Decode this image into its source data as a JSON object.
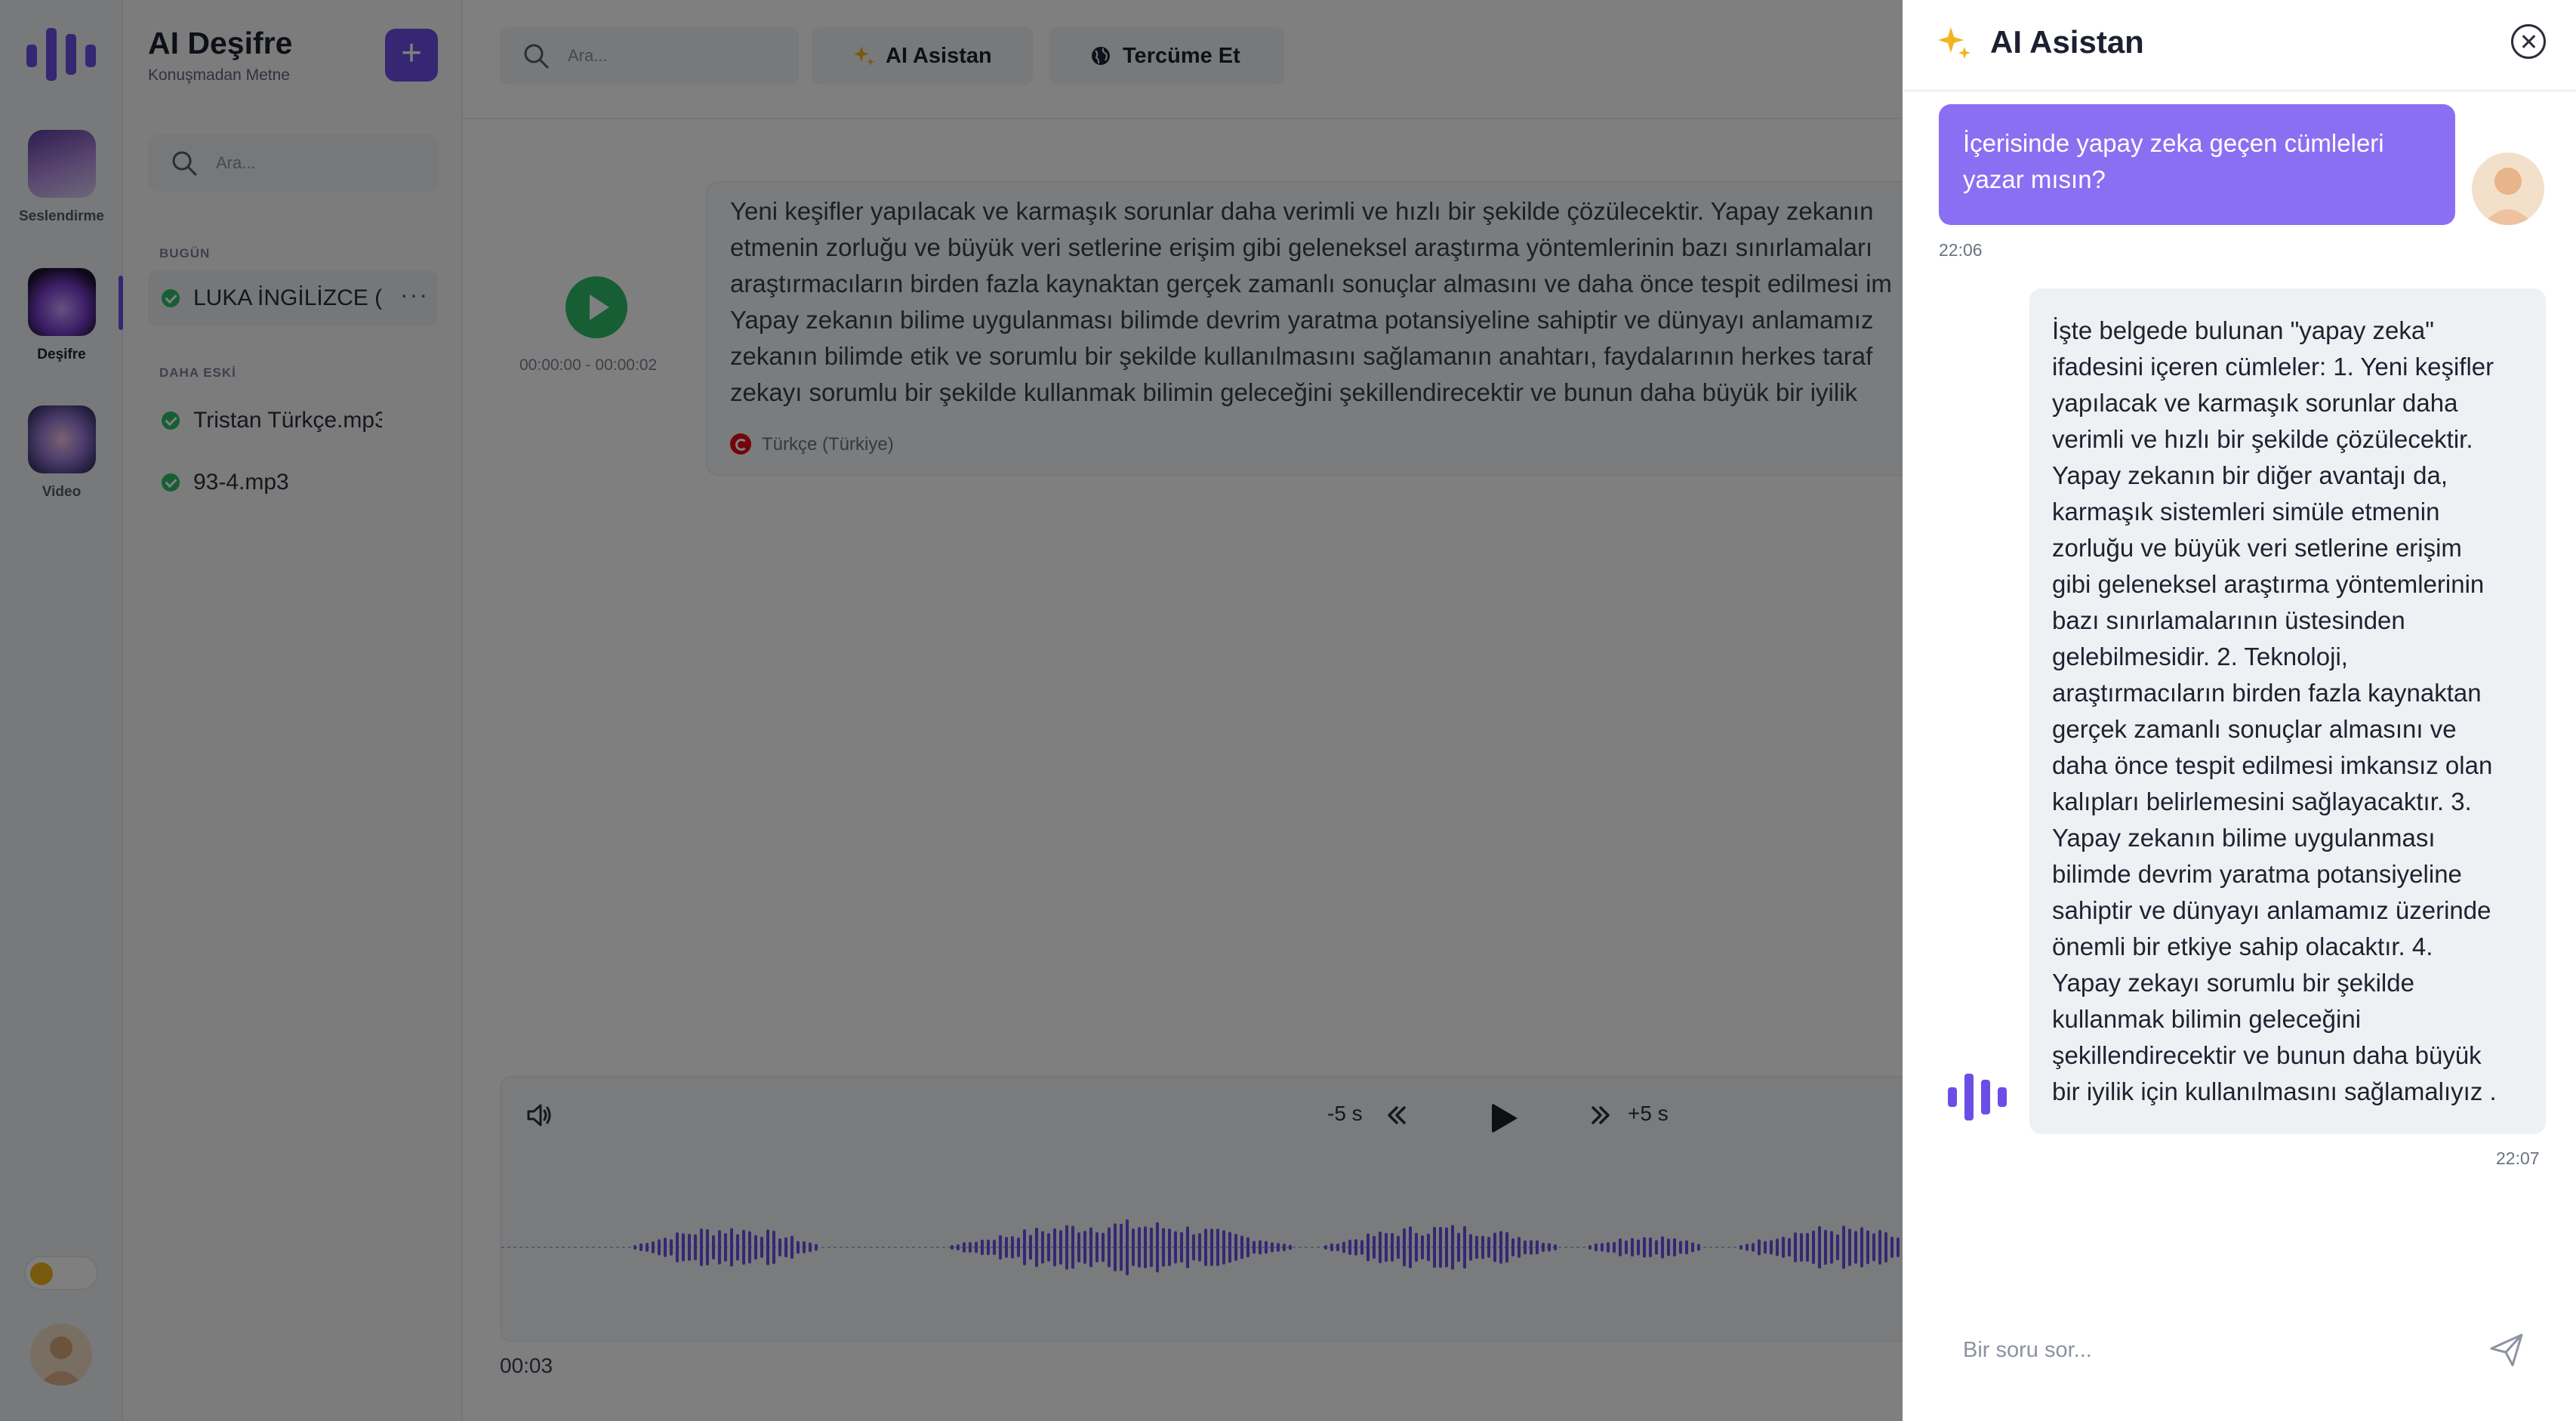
{
  "app": {
    "title": "AI Deşifre",
    "subtitle": "Konuşmadan Metne"
  },
  "colors": {
    "accent": "#6c4ee6",
    "success": "#2fbd68",
    "user_bubble": "#8b6ff2",
    "wave": "#6c4ee6"
  },
  "rail": {
    "items": [
      {
        "label": "Seslendirme",
        "icon": "voiceover-app-icon"
      },
      {
        "label": "Deşifre",
        "icon": "transcribe-app-icon",
        "active": true
      },
      {
        "label": "Video",
        "icon": "video-app-icon"
      }
    ]
  },
  "files": {
    "search_placeholder": "Ara...",
    "groups": [
      {
        "label": "BUGÜN",
        "items": [
          {
            "name": "LUKA İNGİLİZCE (G",
            "active": true
          }
        ]
      },
      {
        "label": "DAHA ESKİ",
        "items": [
          {
            "name": "Tristan Türkçe.mp3"
          },
          {
            "name": "93-4.mp3"
          }
        ]
      }
    ]
  },
  "toolbar": {
    "search_placeholder": "Ara...",
    "ai_button": "AI Asistan",
    "translate_button": "Tercüme Et"
  },
  "segment": {
    "time_range": "00:00:00 - 00:00:02",
    "lines": [
      "Yeni keşifler yapılacak ve karmaşık sorunlar daha verimli ve hızlı bir şekilde çözülecektir. Yapay zekanın",
      "etmenin zorluğu ve büyük veri setlerine erişim gibi geleneksel araştırma yöntemlerinin bazı sınırlamaları",
      "araştırmacıların birden fazla kaynaktan gerçek zamanlı sonuçlar almasını ve daha önce tespit edilmesi im",
      "Yapay zekanın bilime uygulanması bilimde devrim yaratma potansiyeline sahiptir ve dünyayı anlamamız",
      "zekanın bilimde etik ve sorumlu bir şekilde kullanılmasını sağlamanın anahtarı, faydalarının herkes taraf",
      "zekayı sorumlu bir şekilde kullanmak bilimin geleceğini şekillendirecektir ve bunun daha büyük bir iyilik"
    ],
    "language": "Türkçe (Türkiye)"
  },
  "player": {
    "back_label": "-5 s",
    "forward_label": "+5 s",
    "current_time": "00:03"
  },
  "assistant": {
    "title": "AI Asistan",
    "user_message": "İçerisinde yapay zeka geçen cümleleri yazar mısın?",
    "user_time": "22:06",
    "bot_lines": [
      "İşte belgede bulunan \"yapay zeka\"",
      "ifadesini içeren cümleler: 1. Yeni keşifler",
      "yapılacak ve karmaşık sorunlar daha",
      "verimli ve hızlı bir şekilde çözülecektir.",
      "Yapay zekanın bir diğer avantajı da,",
      "karmaşık sistemleri simüle etmenin",
      "zorluğu ve büyük veri setlerine erişim",
      "gibi geleneksel araştırma yöntemlerinin",
      "bazı sınırlamalarının üstesinden",
      "gelebilmesidir. 2. Teknoloji,",
      "araştırmacıların birden fazla kaynaktan",
      "gerçek zamanlı sonuçlar almasını ve",
      "daha önce tespit edilmesi imkansız olan",
      "kalıpları belirlemesini sağlayacaktır. 3.",
      "Yapay zekanın bilime uygulanması",
      "bilimde devrim yaratma potansiyeline",
      "sahiptir ve dünyayı anlamamız üzerinde",
      "önemli bir etkiye sahip olacaktır. 4.",
      "Yapay zekayı sorumlu bir şekilde",
      "kullanmak bilimin geleceğini",
      "şekillendirecektir ve bunun daha büyük",
      "bir iyilik için kullanılmasını sağlamalıyız ."
    ],
    "bot_time": "22:07",
    "input_placeholder": "Bir soru sor..."
  }
}
